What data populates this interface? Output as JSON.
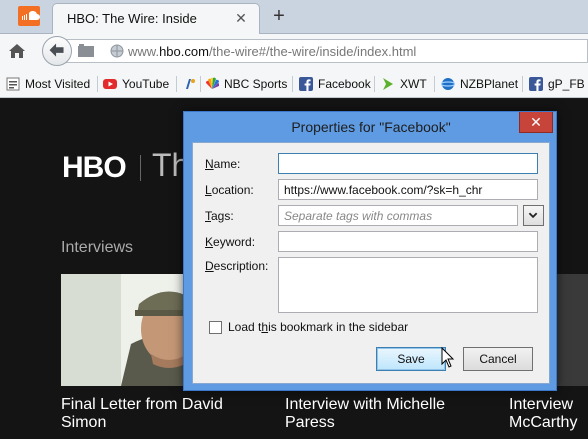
{
  "tab": {
    "title": "HBO: The Wire: Inside",
    "close_glyph": "✕",
    "new_glyph": "+"
  },
  "nav": {
    "url_prefix": "www.",
    "url_host": "hbo.com",
    "url_path": "/the-wire#/the-wire/inside/index.html"
  },
  "bookmarks": [
    {
      "label": "Most Visited",
      "icon": "bookmarks-folder-icon"
    },
    {
      "label": "YouTube",
      "icon": "youtube-icon"
    },
    {
      "label": "",
      "icon": "bookmark-favicon-icon"
    },
    {
      "label": "NBC Sports",
      "icon": "nbc-peacock-icon"
    },
    {
      "label": "Facebook",
      "icon": "facebook-icon"
    },
    {
      "label": "XWT",
      "icon": "xwt-arrow-icon"
    },
    {
      "label": "NZBPlanet",
      "icon": "nzbplanet-icon"
    },
    {
      "label": "gP_FB",
      "icon": "facebook-icon"
    }
  ],
  "page": {
    "logo_text": "HBO",
    "title_fragment": "Th",
    "section_title": "Interviews",
    "captions": [
      {
        "line1": "Final Letter from David",
        "line2": "Simon"
      },
      {
        "line1": "Interview with Michelle",
        "line2": "Paress"
      },
      {
        "line1": "Interview",
        "line2": "McCarthy"
      }
    ]
  },
  "dialog": {
    "title": "Properties for \"Facebook\"",
    "close_glyph": "✕",
    "name_label_u": "N",
    "name_label_rest": "ame:",
    "name_value": "",
    "location_label_u": "L",
    "location_label_rest": "ocation:",
    "location_value": "https://www.facebook.com/?sk=h_chr",
    "tags_label_u": "T",
    "tags_label_rest": "ags:",
    "tags_placeholder": "Separate tags with commas",
    "keyword_label_u": "K",
    "keyword_label_rest": "eyword:",
    "keyword_value": "",
    "description_label_u": "D",
    "description_label_rest": "escription:",
    "description_value": "",
    "sidebar_label_pre": "Load t",
    "sidebar_label_u": "h",
    "sidebar_label_post": "is bookmark in the sidebar",
    "sidebar_checked": false,
    "save_label": "Save",
    "cancel_label": "Cancel"
  },
  "colors": {
    "dialog_frame": "#5f9be3",
    "close_red": "#c7443a",
    "page_bg": "#141414"
  }
}
